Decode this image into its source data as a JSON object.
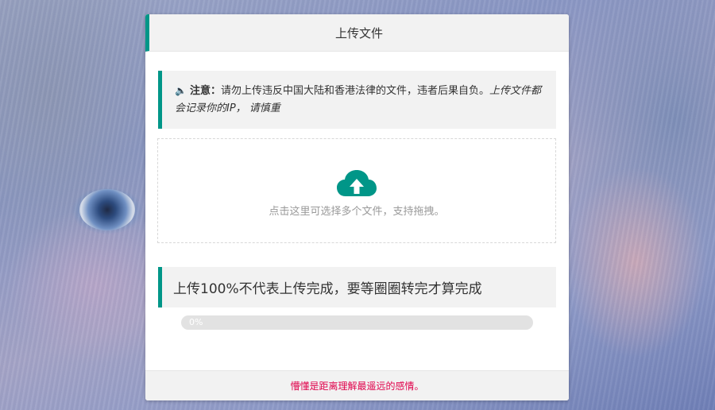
{
  "header": {
    "title": "上传文件"
  },
  "notice": {
    "icon": "speaker-icon",
    "label": "注意：",
    "text": "请勿上传违反中国大陆和香港法律的文件，违者后果自负。",
    "italic": "上传文件都会记录你的IP， 请慎重"
  },
  "dropzone": {
    "icon": "cloud-upload-icon",
    "hint": "点击这里可选择多个文件，支持拖拽。"
  },
  "progress": {
    "title": "上传100%不代表上传完成，要等圈圈转完才算完成",
    "value_percent": 0,
    "label": "0%"
  },
  "footer": {
    "text": "懵懂是距离理解最遥远的感情。"
  },
  "colors": {
    "accent": "#009688",
    "footer_text": "#e0004a"
  }
}
